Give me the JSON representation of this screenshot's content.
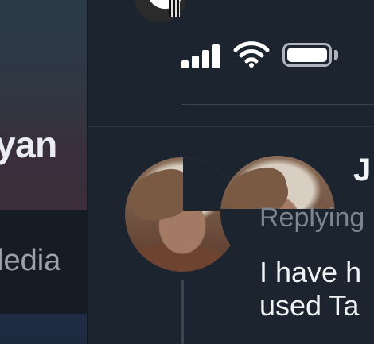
{
  "profile": {
    "name_fragment": "yan",
    "tab_fragment": "ledia"
  },
  "status_bar": {
    "signal_icon": "cellular-signal-icon",
    "wifi_icon": "wifi-icon",
    "battery_icon": "battery-icon",
    "battery_level": 1.0
  },
  "post": {
    "author_fragment": "J",
    "replying_fragment": "Replying",
    "text_lines": [
      "I have h",
      "used Ta"
    ]
  }
}
